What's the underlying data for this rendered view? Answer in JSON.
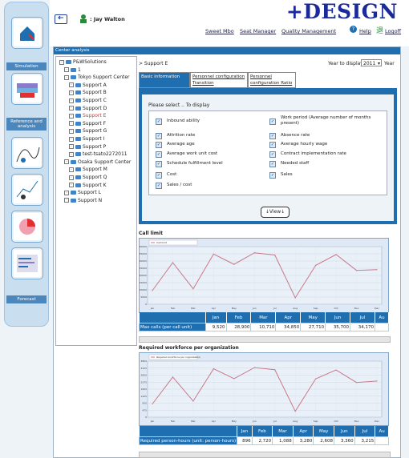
{
  "header": {
    "brand": "+DESIGN",
    "user": ": Jay Walton",
    "links": [
      "Sweet Mbo",
      "Seat Manager",
      "Quality Management",
      "Help",
      "Logoff"
    ]
  },
  "nav": {
    "labels": [
      "Simulation",
      "Reference and analysis",
      "Forecast"
    ]
  },
  "frame_title": "Center analysis",
  "breadcrumb": "> Support E",
  "year": {
    "label": "Year to display",
    "value": "2011",
    "suffix": "Year"
  },
  "tabs": [
    "Basic information",
    "Personnel configuration  Transition",
    "Personnel configuration  Ratio"
  ],
  "select_prompt": "Please select .. To display",
  "checks_left": [
    "Inbound ability",
    "Attrition rate",
    "Average age",
    "Average work unit cost",
    "Schedule fulfillment level",
    "Cost",
    "Sales / cost"
  ],
  "checks_right": [
    "Work period (Average number of months present)",
    "Absence rate",
    "Average hourly wage",
    "Contract implementation rate",
    "Needed  staff",
    "Sales"
  ],
  "view_label": "↓View↓",
  "tree": [
    {
      "label": "P&WSolutions",
      "level": 0,
      "color": "#222"
    },
    {
      "label": "1",
      "level": 1,
      "color": "#222"
    },
    {
      "label": "Tokyo Support Center",
      "level": 1,
      "color": "#222"
    },
    {
      "label": "Support A",
      "level": 2,
      "color": "#222"
    },
    {
      "label": "Support B",
      "level": 2,
      "color": "#222"
    },
    {
      "label": "Support C",
      "level": 2,
      "color": "#222"
    },
    {
      "label": "Support D",
      "level": 2,
      "color": "#222"
    },
    {
      "label": "Support E",
      "level": 2,
      "color": "#e03030"
    },
    {
      "label": "Support F",
      "level": 2,
      "color": "#222"
    },
    {
      "label": "Support G",
      "level": 2,
      "color": "#222"
    },
    {
      "label": "Support I",
      "level": 2,
      "color": "#222"
    },
    {
      "label": "Support P",
      "level": 2,
      "color": "#222"
    },
    {
      "label": "test-tsato2272011",
      "level": 2,
      "color": "#222"
    },
    {
      "label": "Osaka Support Center",
      "level": 1,
      "color": "#222"
    },
    {
      "label": "Support M",
      "level": 2,
      "color": "#222"
    },
    {
      "label": "Support Q",
      "level": 2,
      "color": "#222"
    },
    {
      "label": "Support K",
      "level": 2,
      "color": "#222"
    },
    {
      "label": "Support L",
      "level": 1,
      "color": "#222"
    },
    {
      "label": "Support N",
      "level": 1,
      "color": "#222"
    }
  ],
  "chart_data": [
    {
      "type": "line",
      "title": "Call limit",
      "legend": "Call limit",
      "categories": [
        "Jan",
        "Feb",
        "Mar",
        "Apr",
        "May",
        "Jun",
        "Jul",
        "Aug",
        "Sep",
        "Oct",
        "Nov",
        "Dec"
      ],
      "series": [
        {
          "name": "Call limit",
          "values": [
            9520,
            28900,
            10710,
            34850,
            27710,
            35700,
            34170,
            4500,
            27000,
            34500,
            23500,
            24000
          ]
        }
      ],
      "ylim": [
        0,
        40000
      ],
      "row_label": "Max calls (per call unit)",
      "table_values": [
        "9,520",
        "28,900",
        "10,710",
        "34,850",
        "27,710",
        "35,700",
        "34,170",
        ""
      ],
      "line_color": "#c87a8a"
    },
    {
      "type": "line",
      "title": "Required workforce per organization",
      "legend": "Required workforce per organization",
      "categories": [
        "Jan",
        "Feb",
        "Mar",
        "Apr",
        "May",
        "Jun",
        "Jul",
        "Aug",
        "Sep",
        "Oct",
        "Nov",
        "Dec"
      ],
      "series": [
        {
          "name": "Required workforce per organization",
          "values": [
            896,
            2720,
            1088,
            3280,
            2608,
            3360,
            3215,
            400,
            2600,
            3200,
            2350,
            2450
          ]
        }
      ],
      "ylim": [
        0,
        3800
      ],
      "row_label": "Required person-hours (unit: person-hours)",
      "table_values": [
        "896",
        "2,720",
        "1,088",
        "3,280",
        "2,608",
        "3,360",
        "3,215",
        ""
      ],
      "line_color": "#c87a8a"
    }
  ],
  "table_months": [
    "Jan",
    "Feb",
    "Mar",
    "Apr",
    "May",
    "Jun",
    "Jul",
    "Au"
  ]
}
